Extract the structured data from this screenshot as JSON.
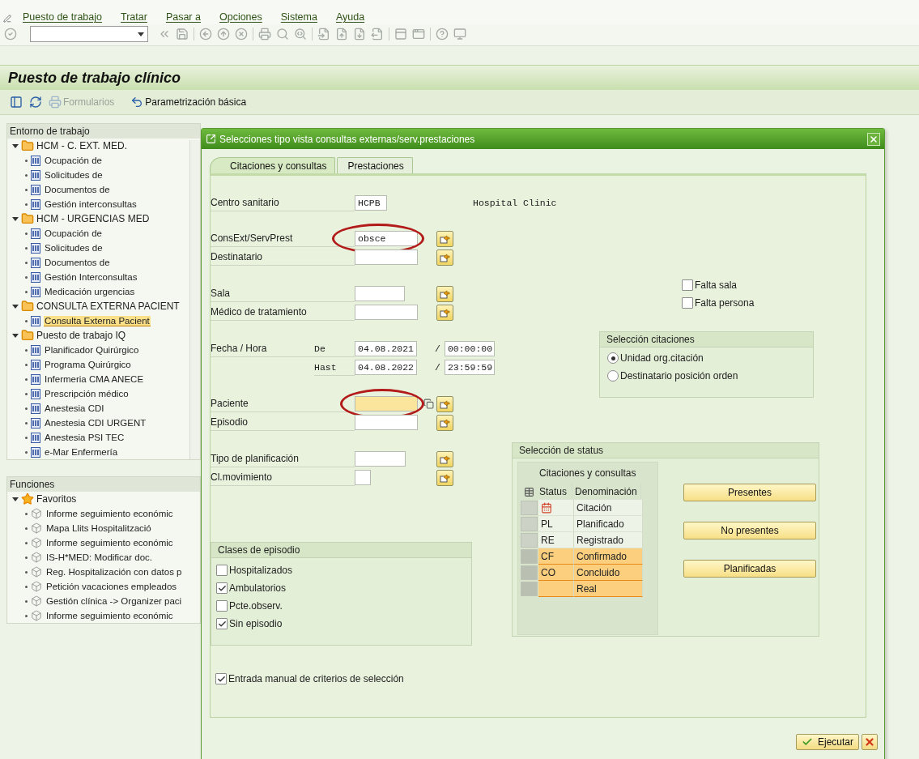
{
  "menu": [
    {
      "label": "Puesto de trabajo"
    },
    {
      "label": "Tratar"
    },
    {
      "label": "Pasar a"
    },
    {
      "label": "Opciones"
    },
    {
      "label": "Sistema"
    },
    {
      "label": "Ayuda"
    }
  ],
  "title": "Puesto de trabajo clínico",
  "app_toolbar": [
    {
      "label": "Formularios",
      "disabled": true
    },
    {
      "label": "Parametrización básica",
      "disabled": false
    }
  ],
  "workspace": {
    "title": "Entorno de trabajo",
    "folders": [
      {
        "label": "HCM - C. EXT. MED.",
        "expanded": true,
        "children": [
          {
            "label": "Ocupación de",
            "selected": false
          },
          {
            "label": "Solicitudes de",
            "selected": false
          },
          {
            "label": "Documentos de",
            "selected": false
          },
          {
            "label": "Gestión interconsultas",
            "selected": false
          }
        ]
      },
      {
        "label": "HCM - URGENCIAS MED",
        "expanded": true,
        "children": [
          {
            "label": "Ocupación de",
            "selected": false
          },
          {
            "label": "Solicitudes de",
            "selected": false
          },
          {
            "label": "Documentos de",
            "selected": false
          },
          {
            "label": "Gestión Interconsultas",
            "selected": false
          },
          {
            "label": "Medicación urgencias",
            "selected": false
          }
        ]
      },
      {
        "label": "CONSULTA EXTERNA PACIENT",
        "expanded": true,
        "children": [
          {
            "label": "Consulta Externa Pacient",
            "selected": true
          }
        ]
      },
      {
        "label": "Puesto de trabajo IQ",
        "expanded": true,
        "children": [
          {
            "label": "Planificador Quirúrgico",
            "selected": false
          },
          {
            "label": "Programa Quirúrgico",
            "selected": false
          },
          {
            "label": "Infermeria CMA ANECE",
            "selected": false
          },
          {
            "label": "Prescripción médico",
            "selected": false
          },
          {
            "label": "Anestesia CDI",
            "selected": false
          },
          {
            "label": "Anestesia CDI URGENT",
            "selected": false
          },
          {
            "label": "Anestesia PSI TEC",
            "selected": false
          },
          {
            "label": "e-Mar Enfermería",
            "selected": false
          }
        ]
      }
    ]
  },
  "functions": {
    "title": "Funciones",
    "folders": [
      {
        "label": "Favoritos",
        "expanded": true,
        "children": [
          {
            "label": "Informe seguimiento económic",
            "selected": false
          },
          {
            "label": "Mapa Llits Hospitalització",
            "selected": false
          },
          {
            "label": "Informe seguimiento económic",
            "selected": false
          },
          {
            "label": "IS-H*MED: Modificar doc.",
            "selected": false
          },
          {
            "label": "Reg. Hospitalización con datos p",
            "selected": false
          },
          {
            "label": "Petición vacaciones empleados",
            "selected": false
          },
          {
            "label": "Gestión clínica -> Organizer paci",
            "selected": false
          },
          {
            "label": "Informe seguimiento económic",
            "selected": false
          }
        ]
      }
    ]
  },
  "dialog": {
    "title": "Selecciones tipo vista consultas externas/serv.prestaciones",
    "tabs": [
      {
        "label": "Citaciones y consultas",
        "selected": true
      },
      {
        "label": "Prestaciones",
        "selected": false
      }
    ],
    "centro": {
      "label": "Centro sanitario",
      "value": "HCPB",
      "description": "Hospital Clinic"
    },
    "field_groups": [
      [
        {
          "kind": "field",
          "label": "ConsExt/ServPrest",
          "value": "obsce",
          "circled": true,
          "focused": false
        },
        {
          "kind": "field",
          "label": "Destinatario",
          "circled": false,
          "focused": false
        }
      ],
      [
        {
          "kind": "field",
          "label": "Sala",
          "circled": false,
          "focused": false
        },
        {
          "kind": "field",
          "label": "Médico de tratamiento",
          "circled": false,
          "focused": false
        }
      ],
      [
        {
          "kind": "range",
          "label": "Fecha / Hora",
          "rows": [
            {
              "prefix": "De",
              "date": "04.08.2021",
              "separator": "/",
              "time": "00:00:00"
            },
            {
              "prefix": "Hast",
              "date": "04.08.2022",
              "separator": "/",
              "time": "23:59:59"
            }
          ]
        }
      ],
      [
        {
          "kind": "field",
          "label": "Paciente",
          "circled": true,
          "focused": true
        },
        {
          "kind": "field",
          "label": "Episodio",
          "circled": false,
          "focused": false
        }
      ],
      [
        {
          "kind": "field",
          "label": "Tipo de planificación",
          "circled": false,
          "focused": false
        },
        {
          "kind": "field",
          "label": "Cl.movimiento",
          "circled": false,
          "focused": false
        }
      ]
    ],
    "missing": [
      {
        "label": "Falta sala",
        "checked": false
      },
      {
        "label": "Falta persona",
        "checked": false
      }
    ],
    "appointment_selection": {
      "title": "Selección citaciones",
      "options": [
        {
          "label": "Unidad org.citación",
          "selected": true
        },
        {
          "label": "Destinatario posición orden",
          "selected": false
        }
      ]
    },
    "episode_classes": {
      "title": "Clases de episodio",
      "items": [
        {
          "label": "Hospitalizados",
          "checked": false
        },
        {
          "label": "Ambulatorios",
          "checked": true
        },
        {
          "label": "Pcte.observ.",
          "checked": false
        },
        {
          "label": "Sin episodio",
          "checked": true
        }
      ]
    },
    "status_selection": {
      "title": "Selección de status",
      "table_title": "Citaciones y consultas",
      "columns": [
        "Status",
        "Denominación"
      ],
      "rows": [
        {
          "kind": "icon",
          "name": "Citación",
          "selected": false
        },
        {
          "kind": "code",
          "status": "PL",
          "name": "Planificado",
          "selected": false
        },
        {
          "kind": "code",
          "status": "RE",
          "name": "Registrado",
          "selected": false
        },
        {
          "kind": "code",
          "status": "CF",
          "name": "Confirmado",
          "selected": true
        },
        {
          "kind": "code",
          "status": "CO",
          "name": "Concluido",
          "selected": true
        },
        {
          "kind": "code",
          "name": "Real",
          "selected": true
        }
      ],
      "buttons": [
        "Presentes",
        "No presentes",
        "Planificadas"
      ]
    },
    "manual_entry": {
      "label": "Entrada manual de criterios de selección",
      "checked": true
    },
    "execute": "Ejecutar"
  }
}
